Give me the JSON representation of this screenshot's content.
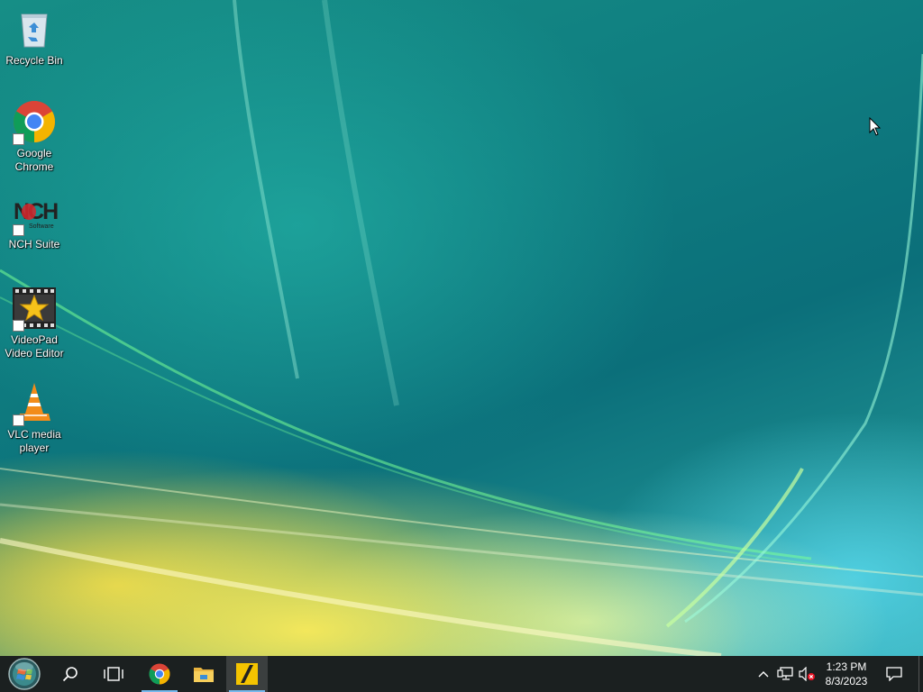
{
  "desktop": {
    "icons": [
      {
        "label": "Recycle Bin",
        "icon": "recycle-bin-icon"
      },
      {
        "label": "Google Chrome",
        "icon": "chrome-icon"
      },
      {
        "label": "NCH Suite",
        "icon": "nch-suite-icon"
      },
      {
        "label": "VideoPad Video Editor",
        "icon": "videopad-icon"
      },
      {
        "label": "VLC media player",
        "icon": "vlc-icon"
      }
    ],
    "nch_logo_text": "NCH",
    "nch_logo_sub": "Software"
  },
  "taskbar": {
    "start": {
      "icon": "start-orb-icon"
    },
    "search": {
      "icon": "search-icon"
    },
    "task_view": {
      "icon": "task-view-icon"
    },
    "pinned": [
      {
        "name": "Google Chrome",
        "icon": "chrome-icon",
        "running": true
      },
      {
        "name": "File Explorer",
        "icon": "file-explorer-icon",
        "running": false
      },
      {
        "name": "NCH Suite",
        "icon": "nch-app-icon",
        "running": true,
        "active": true
      }
    ],
    "tray": {
      "chevron": {
        "icon": "chevron-up-icon"
      },
      "network": {
        "icon": "network-icon"
      },
      "volume": {
        "icon": "volume-muted-icon"
      }
    },
    "clock": {
      "time": "1:23 PM",
      "date": "8/3/2023"
    },
    "notifications": {
      "icon": "action-center-icon"
    }
  },
  "colors": {
    "taskbar_bg": "#1b2020",
    "running_indicator": "#76b9ed",
    "chrome_red": "#db4437",
    "chrome_green": "#0f9d58",
    "chrome_yellow": "#f4b400",
    "chrome_blue": "#4285f4",
    "vlc_orange": "#f28c1a"
  }
}
